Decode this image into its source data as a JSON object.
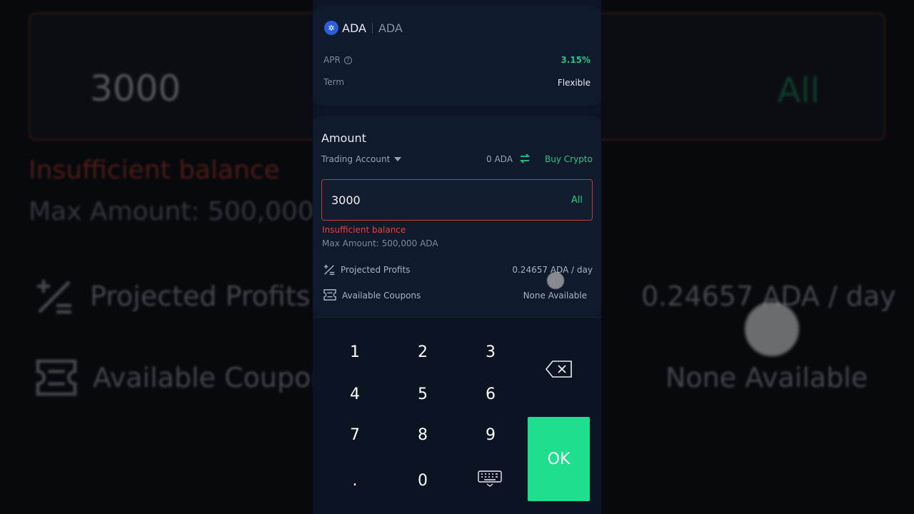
{
  "product": {
    "coin": "ADA",
    "coin_subname": "ADA",
    "apr_label": "APR",
    "apr_value": "3.15%",
    "term_label": "Term",
    "term_value": "Flexible"
  },
  "amount": {
    "title": "Amount",
    "account": "Trading Account",
    "balance": "0 ADA",
    "buy_link": "Buy Crypto",
    "input_value": "3000",
    "all_label": "All",
    "error": "Insufficient balance",
    "max_amount": "Max Amount: 500,000 ADA",
    "projected_label": "Projected Profits",
    "projected_value": "0.24657 ADA / day",
    "coupons_label": "Available Coupons",
    "coupons_value": "None Available"
  },
  "keypad": {
    "k1": "1",
    "k2": "2",
    "k3": "3",
    "k4": "4",
    "k5": "5",
    "k6": "6",
    "k7": "7",
    "k8": "8",
    "k9": "9",
    "kdot": ".",
    "k0": "0",
    "ok": "OK"
  },
  "colors": {
    "accent": "#22c983",
    "error": "#e0463c",
    "ok_button": "#1ddf8e",
    "background": "#0b1525"
  },
  "icons": [
    "ada-coin-icon",
    "help-icon",
    "caret-down-icon",
    "transfer-icon",
    "projected-profits-icon",
    "coupon-icon",
    "backspace-icon",
    "keyboard-icon"
  ]
}
